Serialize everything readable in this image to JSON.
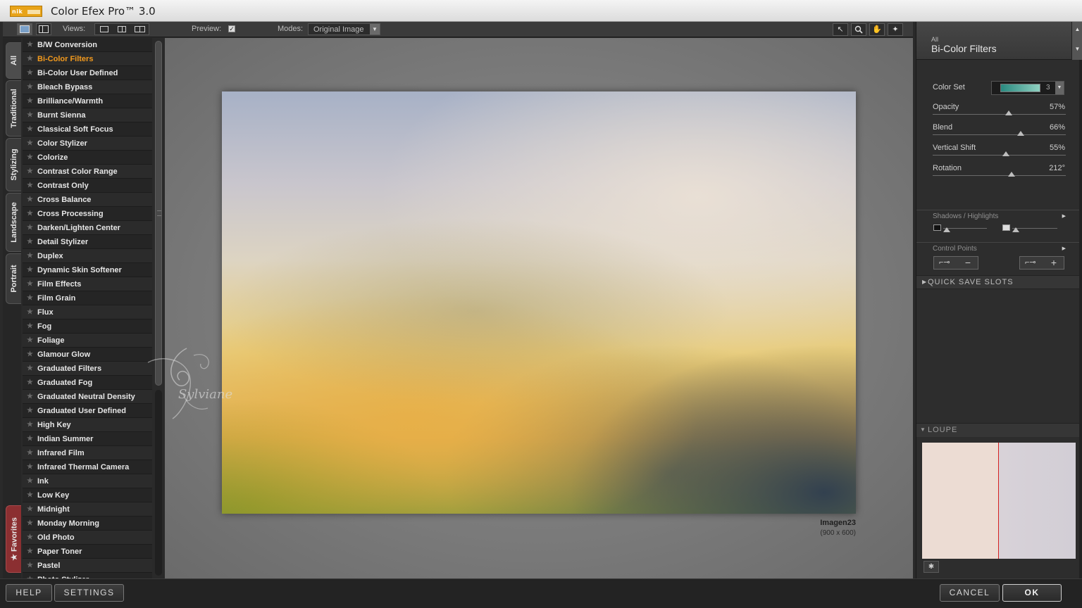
{
  "window": {
    "title": "Color Efex Pro™ 3.0",
    "logo_text": "nik"
  },
  "toolbar": {
    "views_label": "Views:",
    "preview_label": "Preview:",
    "preview_checked": true,
    "modes_label": "Modes:",
    "modes_value": "Original Image"
  },
  "sidetabs": {
    "all": "All",
    "traditional": "Traditional",
    "stylizing": "Stylizing",
    "landscape": "Landscape",
    "portrait": "Portrait",
    "favorites": "Favorites"
  },
  "filters": [
    "B/W Conversion",
    "Bi-Color Filters",
    "Bi-Color User Defined",
    "Bleach Bypass",
    "Brilliance/Warmth",
    "Burnt Sienna",
    "Classical Soft Focus",
    "Color Stylizer",
    "Colorize",
    "Contrast Color Range",
    "Contrast Only",
    "Cross Balance",
    "Cross Processing",
    "Darken/Lighten Center",
    "Detail Stylizer",
    "Duplex",
    "Dynamic Skin Softener",
    "Film Effects",
    "Film Grain",
    "Flux",
    "Fog",
    "Foliage",
    "Glamour Glow",
    "Graduated Filters",
    "Graduated Fog",
    "Graduated Neutral Density",
    "Graduated User Defined",
    "High Key",
    "Indian Summer",
    "Infrared Film",
    "Infrared Thermal Camera",
    "Ink",
    "Low Key",
    "Midnight",
    "Monday Morning",
    "Old Photo",
    "Paper Toner",
    "Pastel",
    "Photo Stylizer"
  ],
  "selected_filter": "Bi-Color Filters",
  "image": {
    "name": "Imagen23",
    "size": "(900 x 600)"
  },
  "panel": {
    "breadcrumb": "All",
    "title": "Bi-Color Filters",
    "color_set_label": "Color Set",
    "color_set_value": "3",
    "params": [
      {
        "label": "Opacity",
        "value": "57%",
        "level": 0.57
      },
      {
        "label": "Blend",
        "value": "66%",
        "level": 0.66
      },
      {
        "label": "Vertical Shift",
        "value": "55%",
        "level": 0.55
      },
      {
        "label": "Rotation",
        "value": "212°",
        "level": 0.59
      }
    ],
    "shadows_highlights": "Shadows / Highlights",
    "control_points": "Control Points",
    "quick_save": "QUICK SAVE SLOTS",
    "loupe": "LOUPE"
  },
  "bottom": {
    "help": "HELP",
    "settings": "SETTINGS",
    "cancel": "CANCEL",
    "ok": "OK"
  },
  "watermark": "Sylviane",
  "colors": {
    "accent": "#f39a1d",
    "favorites_tab": "#8b2f31",
    "loupe_line": "#d42020"
  }
}
